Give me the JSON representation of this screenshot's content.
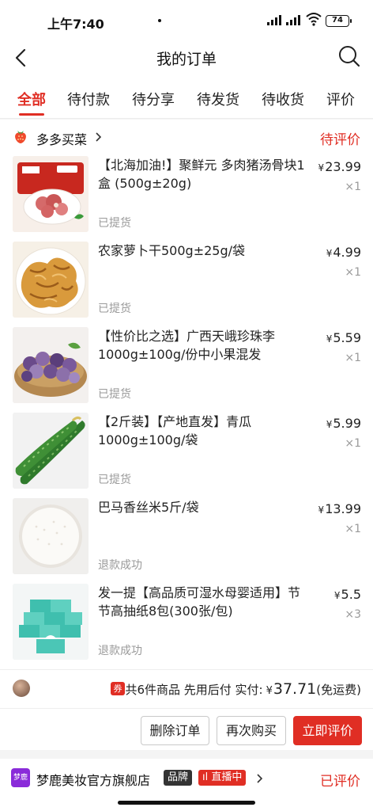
{
  "status_bar": {
    "time": "上午7:40",
    "battery": "74"
  },
  "nav": {
    "title": "我的订单",
    "back_icon": "back-arrow-icon",
    "search_icon": "search-icon"
  },
  "tabs": [
    "全部",
    "待付款",
    "待分享",
    "待发货",
    "待收货",
    "评价"
  ],
  "active_tab": "全部",
  "order": {
    "shop_name": "多多买菜",
    "status": "待评价",
    "items": [
      {
        "name": "【北海加油!】聚鲜元 多肉猪汤骨块1盒 (500g±20g)",
        "price": "23.99",
        "qty": "×1",
        "status": "已提货"
      },
      {
        "name": "农家萝卜干500g±25g/袋",
        "price": "4.99",
        "qty": "×1",
        "status": "已提货"
      },
      {
        "name": "【性价比之选】广西天峨珍珠李1000g±100g/份中小果混发",
        "price": "5.59",
        "qty": "×1",
        "status": "已提货"
      },
      {
        "name": "【2斤装】【产地直发】青瓜1000g±100g/袋",
        "price": "5.99",
        "qty": "×1",
        "status": "已提货"
      },
      {
        "name": "巴马香丝米5斤/袋",
        "price": "13.99",
        "qty": "×1",
        "status": "退款成功"
      },
      {
        "name": "发一提【高品质可湿水母婴适用】节节高抽纸8包(300张/包)",
        "price": "5.5",
        "qty": "×3",
        "status": "退款成功"
      }
    ],
    "currency": "¥",
    "coupon_badge": "券",
    "summary_prefix": "共6件商品 先用后付 实付:",
    "total": "37.71",
    "shipping_note": "(免运费)",
    "buttons": {
      "delete": "删除订单",
      "rebuy": "再次购买",
      "review": "立即评价"
    }
  },
  "order2": {
    "shop_logo_text": "梦鹿",
    "shop_name": "梦鹿美妆官方旗舰店",
    "brand_tag": "品牌",
    "live_tag": "直播中",
    "status": "已评价"
  },
  "colors": {
    "accent": "#e02e24",
    "text": "#222222",
    "muted": "#9a9a9a",
    "page_bg": "#f4f4f4"
  }
}
